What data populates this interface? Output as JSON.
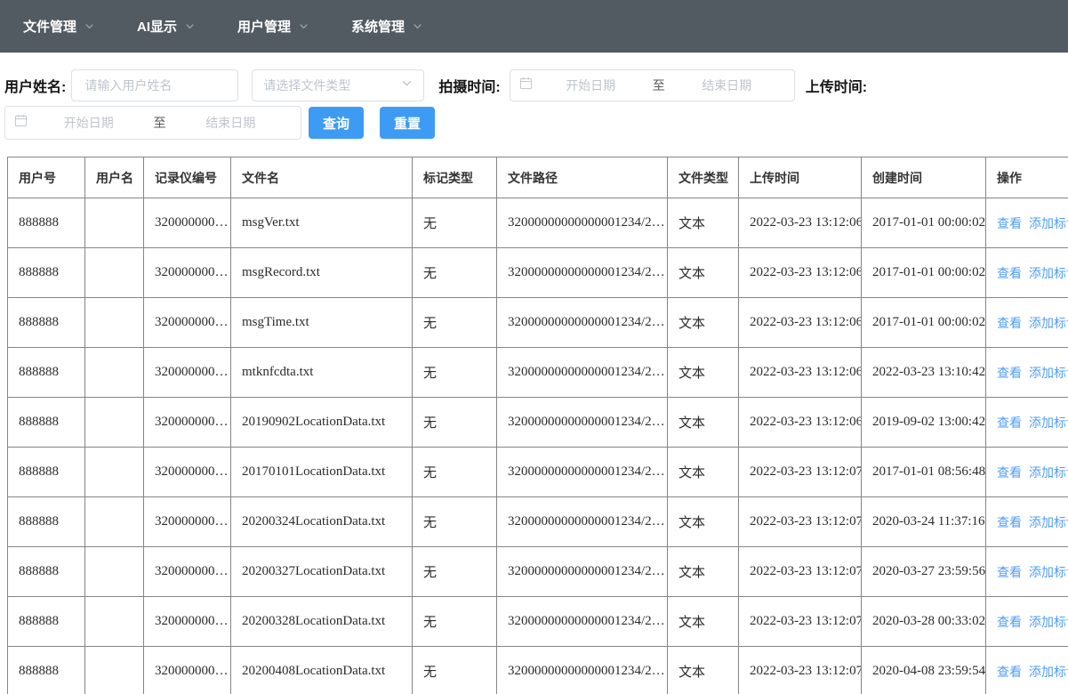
{
  "colors": {
    "accent": "#409EFF",
    "nav_bg": "#525A62",
    "link": "#4F9DF7",
    "border": "#858585"
  },
  "nav": {
    "items": [
      {
        "label": "文件管理"
      },
      {
        "label": "AI显示"
      },
      {
        "label": "用户管理"
      },
      {
        "label": "系统管理"
      }
    ]
  },
  "filters": {
    "user_name_label": "用户姓名:",
    "user_name_placeholder": "请输入用户姓名",
    "file_type_placeholder": "请选择文件类型",
    "shoot_time_label": "拍摄时间:",
    "upload_time_label": "上传时间:",
    "date_start_placeholder": "开始日期",
    "date_separator": "至",
    "date_end_placeholder": "结束日期",
    "search_button": "查询",
    "reset_button": "重置"
  },
  "table": {
    "headers": [
      "用户号",
      "用户名",
      "记录仪编号",
      "文件名",
      "标记类型",
      "文件路径",
      "文件类型",
      "上传时间",
      "创建时间",
      "操作"
    ],
    "actions": {
      "view": "查看",
      "add_mark": "添加标记"
    },
    "rows": [
      {
        "user_id": "888888",
        "user_name": "",
        "recorder_no": "320000000…",
        "file_name": "msgVer.txt",
        "mark_type": "无",
        "file_path": "32000000000000001234/2…",
        "file_type": "文本",
        "upload_time": "2022-03-23 13:12:06",
        "create_time": "2017-01-01 00:00:02"
      },
      {
        "user_id": "888888",
        "user_name": "",
        "recorder_no": "320000000…",
        "file_name": "msgRecord.txt",
        "mark_type": "无",
        "file_path": "32000000000000001234/2…",
        "file_type": "文本",
        "upload_time": "2022-03-23 13:12:06",
        "create_time": "2017-01-01 00:00:02"
      },
      {
        "user_id": "888888",
        "user_name": "",
        "recorder_no": "320000000…",
        "file_name": "msgTime.txt",
        "mark_type": "无",
        "file_path": "32000000000000001234/2…",
        "file_type": "文本",
        "upload_time": "2022-03-23 13:12:06",
        "create_time": "2017-01-01 00:00:02"
      },
      {
        "user_id": "888888",
        "user_name": "",
        "recorder_no": "320000000…",
        "file_name": "mtknfcdta.txt",
        "mark_type": "无",
        "file_path": "32000000000000001234/2…",
        "file_type": "文本",
        "upload_time": "2022-03-23 13:12:06",
        "create_time": "2022-03-23 13:10:42"
      },
      {
        "user_id": "888888",
        "user_name": "",
        "recorder_no": "320000000…",
        "file_name": "20190902LocationData.txt",
        "mark_type": "无",
        "file_path": "32000000000000001234/2…",
        "file_type": "文本",
        "upload_time": "2022-03-23 13:12:06",
        "create_time": "2019-09-02 13:00:42"
      },
      {
        "user_id": "888888",
        "user_name": "",
        "recorder_no": "320000000…",
        "file_name": "20170101LocationData.txt",
        "mark_type": "无",
        "file_path": "32000000000000001234/2…",
        "file_type": "文本",
        "upload_time": "2022-03-23 13:12:07",
        "create_time": "2017-01-01 08:56:48"
      },
      {
        "user_id": "888888",
        "user_name": "",
        "recorder_no": "320000000…",
        "file_name": "20200324LocationData.txt",
        "mark_type": "无",
        "file_path": "32000000000000001234/2…",
        "file_type": "文本",
        "upload_time": "2022-03-23 13:12:07",
        "create_time": "2020-03-24 11:37:16"
      },
      {
        "user_id": "888888",
        "user_name": "",
        "recorder_no": "320000000…",
        "file_name": "20200327LocationData.txt",
        "mark_type": "无",
        "file_path": "32000000000000001234/2…",
        "file_type": "文本",
        "upload_time": "2022-03-23 13:12:07",
        "create_time": "2020-03-27 23:59:56"
      },
      {
        "user_id": "888888",
        "user_name": "",
        "recorder_no": "320000000…",
        "file_name": "20200328LocationData.txt",
        "mark_type": "无",
        "file_path": "32000000000000001234/2…",
        "file_type": "文本",
        "upload_time": "2022-03-23 13:12:07",
        "create_time": "2020-03-28 00:33:02"
      },
      {
        "user_id": "888888",
        "user_name": "",
        "recorder_no": "320000000…",
        "file_name": "20200408LocationData.txt",
        "mark_type": "无",
        "file_path": "32000000000000001234/2…",
        "file_type": "文本",
        "upload_time": "2022-03-23 13:12:07",
        "create_time": "2020-04-08 23:59:54"
      }
    ]
  }
}
